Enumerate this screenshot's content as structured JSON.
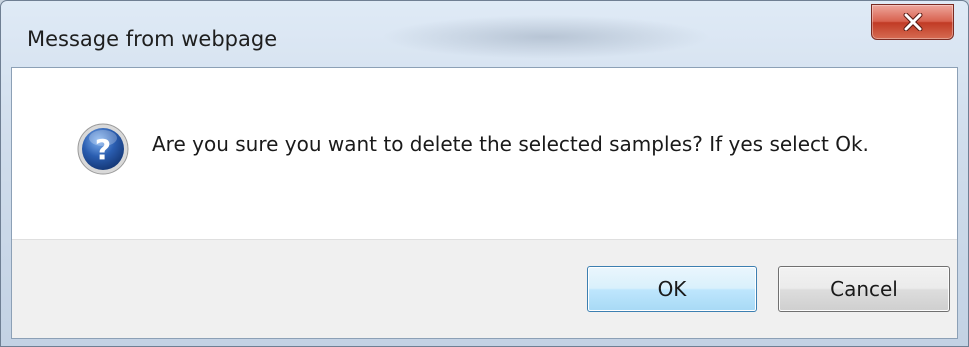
{
  "dialog": {
    "title": "Message from webpage",
    "message": "Are you sure you want to delete the selected samples? If yes select Ok.",
    "icon": "question-icon",
    "close_icon": "close-icon",
    "buttons": {
      "ok": "OK",
      "cancel": "Cancel"
    }
  },
  "colors": {
    "close_button": "#c13b25",
    "default_button_border": "#3c7fb1",
    "button_area": "#f0f0f0",
    "question_icon": "#2a5db0"
  }
}
